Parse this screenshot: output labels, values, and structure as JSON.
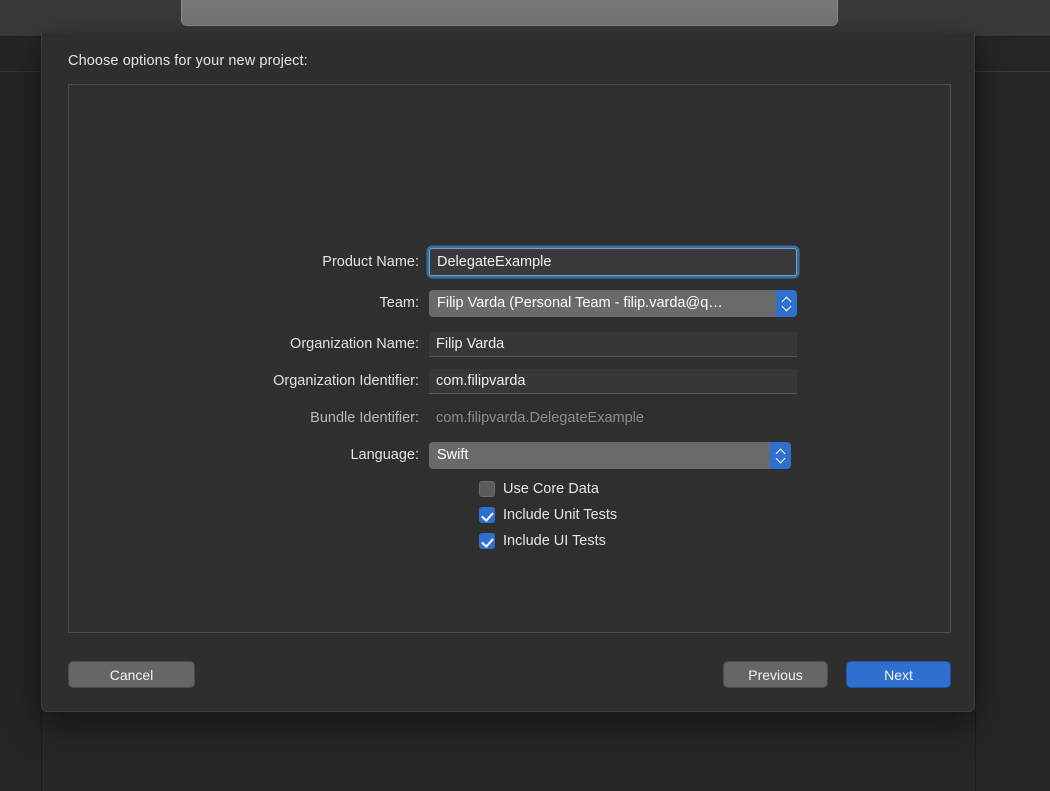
{
  "background": {
    "window_name": "host-window",
    "sheet_anchor_label": ""
  },
  "dialog": {
    "title": "Choose options for your new project:",
    "fields": [
      {
        "label": "Product Name:",
        "value": "DelegateExample",
        "type": "textfield-focused"
      },
      {
        "label": "Team:",
        "value": "Filip Varda (Personal Team - filip.varda@q…",
        "type": "popup"
      },
      {
        "label": "Organization Name:",
        "value": "Filip Varda",
        "type": "textfield"
      },
      {
        "label": "Organization Identifier:",
        "value": "com.filipvarda",
        "type": "textfield"
      },
      {
        "label": "Bundle Identifier:",
        "value": "com.filipvarda.DelegateExample",
        "type": "readonly"
      },
      {
        "label": "Language:",
        "value": "Swift",
        "type": "popup"
      }
    ],
    "checkboxes": [
      {
        "label": "Use Core Data",
        "checked": false
      },
      {
        "label": "Include Unit Tests",
        "checked": true
      },
      {
        "label": "Include UI Tests",
        "checked": true
      }
    ],
    "buttons": {
      "cancel": "Cancel",
      "previous": "Previous",
      "next": "Next"
    }
  },
  "colors": {
    "accent_blue": "#2f6fd0",
    "focus_ring": "#387ab6",
    "sheet_bg": "#2e2e2e",
    "field_bg": "#373737",
    "popup_bg": "#6a6a6a",
    "text_primary": "#f0f0f0",
    "text_muted": "#8d8d8d"
  },
  "icons": {
    "stepper_up": "chevron-up-icon",
    "stepper_down": "chevron-down-icon",
    "checkmark": "checkmark-icon"
  }
}
